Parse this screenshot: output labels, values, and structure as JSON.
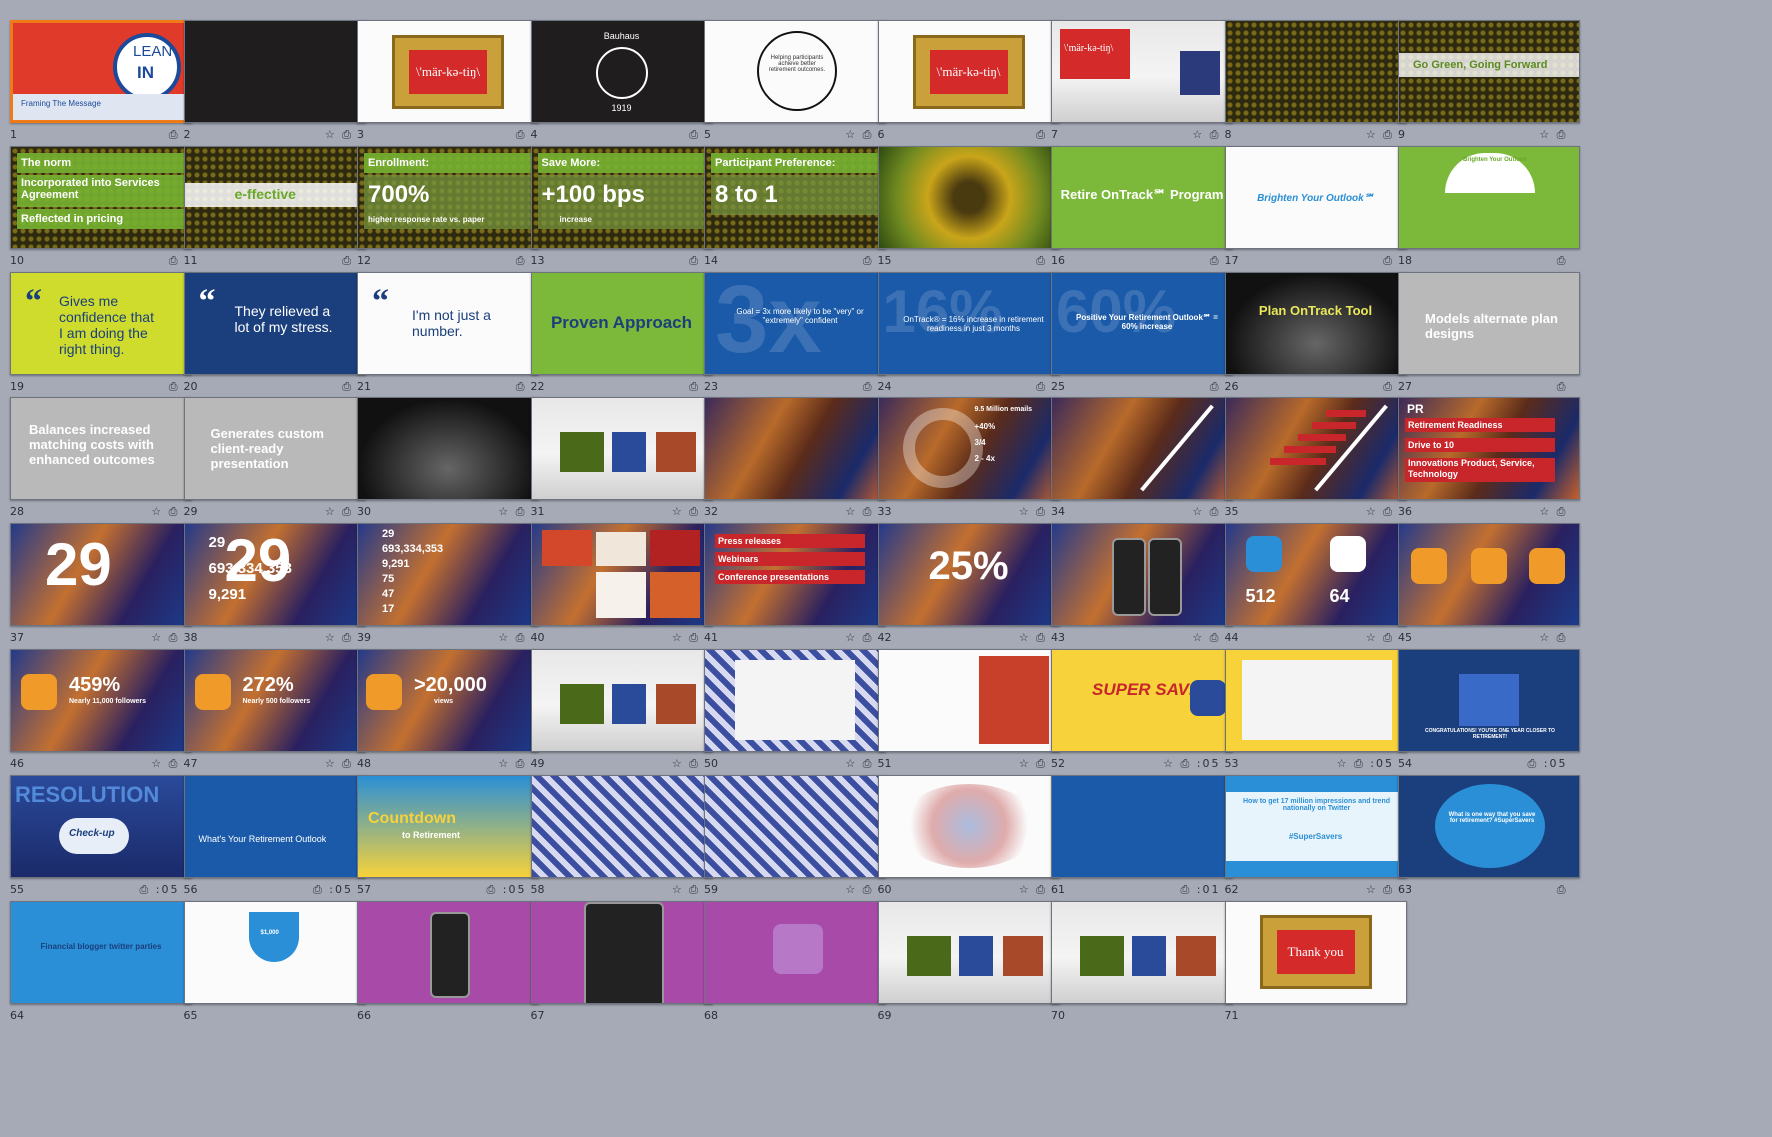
{
  "slides": [
    {
      "n": "1",
      "icons": "⎙",
      "selected": true
    },
    {
      "n": "2",
      "icons": "☆ ⎙"
    },
    {
      "n": "3",
      "icons": "⎙"
    },
    {
      "n": "4",
      "icons": "⎙"
    },
    {
      "n": "5",
      "icons": "☆ ⎙"
    },
    {
      "n": "6",
      "icons": "⎙"
    },
    {
      "n": "7",
      "icons": "☆ ⎙"
    },
    {
      "n": "8",
      "icons": "☆ ⎙"
    },
    {
      "n": "9",
      "icons": "☆ ⎙"
    },
    {
      "n": "10",
      "icons": "⎙"
    },
    {
      "n": "11",
      "icons": "⎙"
    },
    {
      "n": "12",
      "icons": "⎙"
    },
    {
      "n": "13",
      "icons": "⎙"
    },
    {
      "n": "14",
      "icons": "⎙"
    },
    {
      "n": "15",
      "icons": "⎙"
    },
    {
      "n": "16",
      "icons": "⎙"
    },
    {
      "n": "17",
      "icons": "⎙"
    },
    {
      "n": "18",
      "icons": "⎙"
    },
    {
      "n": "19",
      "icons": "⎙"
    },
    {
      "n": "20",
      "icons": "⎙"
    },
    {
      "n": "21",
      "icons": "⎙"
    },
    {
      "n": "22",
      "icons": "⎙"
    },
    {
      "n": "23",
      "icons": "⎙"
    },
    {
      "n": "24",
      "icons": "⎙"
    },
    {
      "n": "25",
      "icons": "⎙"
    },
    {
      "n": "26",
      "icons": "⎙"
    },
    {
      "n": "27",
      "icons": "⎙"
    },
    {
      "n": "28",
      "icons": "☆ ⎙"
    },
    {
      "n": "29",
      "icons": "☆ ⎙"
    },
    {
      "n": "30",
      "icons": "☆ ⎙"
    },
    {
      "n": "31",
      "icons": "☆ ⎙"
    },
    {
      "n": "32",
      "icons": "☆ ⎙"
    },
    {
      "n": "33",
      "icons": "☆ ⎙"
    },
    {
      "n": "34",
      "icons": "☆ ⎙"
    },
    {
      "n": "35",
      "icons": "☆ ⎙"
    },
    {
      "n": "36",
      "icons": "☆ ⎙"
    },
    {
      "n": "37",
      "icons": "☆ ⎙"
    },
    {
      "n": "38",
      "icons": "☆ ⎙"
    },
    {
      "n": "39",
      "icons": "☆ ⎙"
    },
    {
      "n": "40",
      "icons": "☆ ⎙"
    },
    {
      "n": "41",
      "icons": "☆ ⎙"
    },
    {
      "n": "42",
      "icons": "☆ ⎙"
    },
    {
      "n": "43",
      "icons": "☆ ⎙"
    },
    {
      "n": "44",
      "icons": "☆ ⎙"
    },
    {
      "n": "45",
      "icons": "☆ ⎙"
    },
    {
      "n": "46",
      "icons": "☆ ⎙"
    },
    {
      "n": "47",
      "icons": "☆ ⎙"
    },
    {
      "n": "48",
      "icons": "☆ ⎙"
    },
    {
      "n": "49",
      "icons": "☆ ⎙"
    },
    {
      "n": "50",
      "icons": "☆ ⎙"
    },
    {
      "n": "51",
      "icons": "☆ ⎙"
    },
    {
      "n": "52",
      "icons": "☆ ⎙ :05"
    },
    {
      "n": "53",
      "icons": "☆ ⎙ :05"
    },
    {
      "n": "54",
      "icons": "⎙ :05"
    },
    {
      "n": "55",
      "icons": "⎙ :05"
    },
    {
      "n": "56",
      "icons": "⎙ :05"
    },
    {
      "n": "57",
      "icons": "⎙ :05"
    },
    {
      "n": "58",
      "icons": "☆ ⎙"
    },
    {
      "n": "59",
      "icons": "☆ ⎙"
    },
    {
      "n": "60",
      "icons": "☆ ⎙"
    },
    {
      "n": "61",
      "icons": "⎙ :01"
    },
    {
      "n": "62",
      "icons": "☆ ⎙"
    },
    {
      "n": "63",
      "icons": "⎙"
    },
    {
      "n": "64",
      "icons": ""
    },
    {
      "n": "65",
      "icons": ""
    },
    {
      "n": "66",
      "icons": ""
    },
    {
      "n": "67",
      "icons": ""
    },
    {
      "n": "68",
      "icons": ""
    },
    {
      "n": "69",
      "icons": ""
    },
    {
      "n": "70",
      "icons": ""
    },
    {
      "n": "71",
      "icons": ""
    }
  ],
  "text": {
    "s1_lean": "LEAN",
    "s1_in": "IN",
    "s1_caption": "Framing The Message",
    "s3": "\\'mär-kə-tiŋ\\",
    "s4_top": "Bauhaus",
    "s4_year": "1919",
    "s5": "Helping participants achieve better retirement outcomes.",
    "s6": "\\'mär-kə-tiŋ\\",
    "s7": "\\'mär-kə-tiŋ\\",
    "s9": "Go Green, Going Forward",
    "s10_a": "The norm",
    "s10_b": "Incorporated into Services Agreement",
    "s10_c": "Reflected in pricing",
    "s11": "e-ffective",
    "s12_a": "Enrollment:",
    "s12_b": "700%",
    "s12_c": "higher response rate vs. paper",
    "s13_a": "Save More:",
    "s13_b": "+100 bps",
    "s13_c": "increase",
    "s14_a": "Participant Preference:",
    "s14_b": "8 to 1",
    "s16": "Retire OnTrack℠ Program",
    "s17": "Brighten Your Outlook℠",
    "s18": "Brighten Your Outlook",
    "s19": "Gives me confidence that I am doing the right thing.",
    "s20": "They relieved a lot of my stress.",
    "s21": "I'm not just a number.",
    "s22": "Proven Approach",
    "s23_big": "3x",
    "s23": "Goal = 3x more likely to be \"very\" or \"extremely\" confident",
    "s24_big": "16%",
    "s24": "OnTrack® = 16% increase in retirement readiness in just 3 months",
    "s25_big": "60%",
    "s25": "Positive Your Retirement Outlook℠ = 60% increase",
    "s26": "Plan OnTrack Tool",
    "s27": "Models alternate plan designs",
    "s28": "Balances increased matching costs with enhanced outcomes",
    "s29": "Generates custom client-ready presentation",
    "s33_a": "9.5 Million emails",
    "s33_b": "+40%",
    "s33_c": "3/4",
    "s33_d": "2 - 4x",
    "s36_pr": "PR",
    "s36_a": "Retirement Readiness",
    "s36_b": "Drive to 10",
    "s36_c": "Innovations Product, Service, Technology",
    "s37": "29",
    "s38_a": "29",
    "s38_b": "693,334,353",
    "s38_c": "9,291",
    "s39_a": "29",
    "s39_b": "693,334,353",
    "s39_c": "9,291",
    "s39_d": "75",
    "s39_e": "47",
    "s39_f": "17",
    "s41_a": "Press releases",
    "s41_b": "Webinars",
    "s41_c": "Conference presentations",
    "s42": "25%",
    "s44_a": "512",
    "s44_b": "64",
    "s46_a": "459%",
    "s46_b": "Nearly 11,000 followers",
    "s47_a": "272%",
    "s47_b": "Nearly 500 followers",
    "s48_a": ">20,000",
    "s48_b": "views",
    "s52": "SUPER SAVER",
    "s54": "CONGRATULATIONS! YOU'RE ONE YEAR CLOSER TO RETIREMENT!",
    "s55_a": "RESOLUTION",
    "s55_b": "Check-up",
    "s56": "What's Your Retirement Outlook",
    "s57_a": "Countdown",
    "s57_b": "to Retirement",
    "s62_a": "How to get 17 million impressions and trend nationally on Twitter",
    "s62_b": "#SuperSavers",
    "s63": "What is one way that you save for retirement? #SuperSavers",
    "s64": "Financial blogger twitter parties",
    "s65": "$1,000",
    "s71": "Thank you"
  }
}
